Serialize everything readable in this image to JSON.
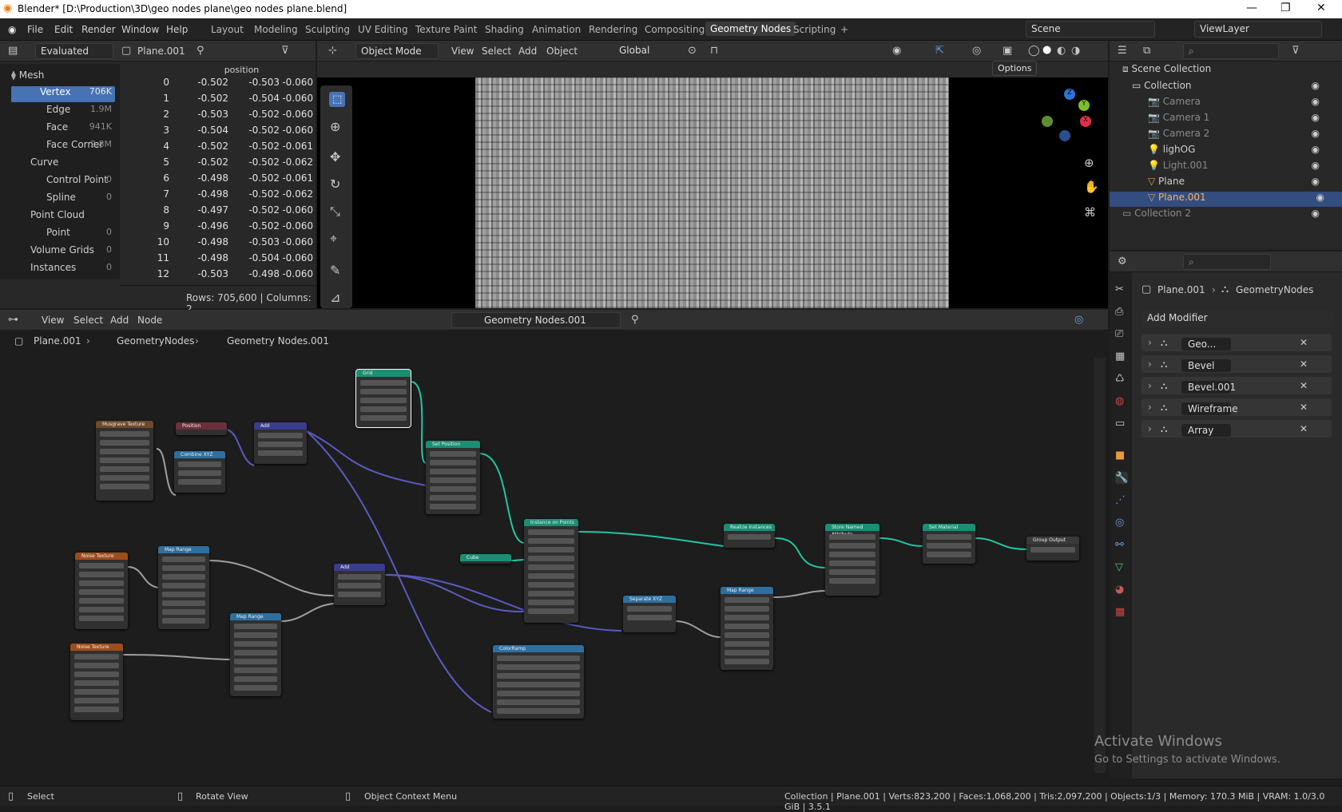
{
  "title": "Blender* [D:\\Production\\3D\\geo nodes plane\\geo nodes plane.blend]",
  "menu": [
    "File",
    "Edit",
    "Render",
    "Window",
    "Help"
  ],
  "workspaces": [
    "Layout",
    "Modeling",
    "Sculpting",
    "UV Editing",
    "Texture Paint",
    "Shading",
    "Animation",
    "Rendering",
    "Compositing",
    "Geometry Nodes",
    "Scripting"
  ],
  "scene": "Scene",
  "view_layer": "ViewLayer",
  "spreadsheet": {
    "mode": "Evaluated",
    "object": "Plane.001",
    "column": "position",
    "sidebar": [
      {
        "label": "Mesh",
        "count": ""
      },
      {
        "label": "Vertex",
        "count": "706K"
      },
      {
        "label": "Edge",
        "count": "1.9M"
      },
      {
        "label": "Face",
        "count": "941K"
      },
      {
        "label": "Face Corner",
        "count": "2.8M"
      },
      {
        "label": "Curve",
        "count": ""
      },
      {
        "label": "Control Point",
        "count": "0"
      },
      {
        "label": "Spline",
        "count": "0"
      },
      {
        "label": "Point Cloud",
        "count": ""
      },
      {
        "label": "Point",
        "count": "0"
      },
      {
        "label": "Volume Grids",
        "count": "0"
      },
      {
        "label": "Instances",
        "count": "0"
      }
    ],
    "rows": [
      [
        "0",
        "-0.502",
        "-0.503",
        "-0.060"
      ],
      [
        "1",
        "-0.502",
        "-0.504",
        "-0.060"
      ],
      [
        "2",
        "-0.503",
        "-0.502",
        "-0.060"
      ],
      [
        "3",
        "-0.504",
        "-0.502",
        "-0.060"
      ],
      [
        "4",
        "-0.502",
        "-0.502",
        "-0.061"
      ],
      [
        "5",
        "-0.502",
        "-0.502",
        "-0.062"
      ],
      [
        "6",
        "-0.498",
        "-0.502",
        "-0.061"
      ],
      [
        "7",
        "-0.498",
        "-0.502",
        "-0.062"
      ],
      [
        "8",
        "-0.497",
        "-0.502",
        "-0.060"
      ],
      [
        "9",
        "-0.496",
        "-0.502",
        "-0.060"
      ],
      [
        "10",
        "-0.498",
        "-0.503",
        "-0.060"
      ],
      [
        "11",
        "-0.498",
        "-0.504",
        "-0.060"
      ],
      [
        "12",
        "-0.503",
        "-0.498",
        "-0.060"
      ]
    ],
    "footer": "Rows: 705,600   |   Columns: 2"
  },
  "viewport": {
    "mode": "Object Mode",
    "menu": [
      "View",
      "Select",
      "Add",
      "Object"
    ],
    "orient": "Global",
    "options": "Options"
  },
  "outliner": {
    "root": "Scene Collection",
    "items": [
      {
        "label": "Collection"
      },
      {
        "label": "Camera"
      },
      {
        "label": "Camera 1"
      },
      {
        "label": "Camera 2"
      },
      {
        "label": "lighOG"
      },
      {
        "label": "Light.001"
      },
      {
        "label": "Plane"
      },
      {
        "label": "Plane.001"
      },
      {
        "label": "Collection 2"
      }
    ]
  },
  "properties": {
    "object": "Plane.001",
    "modifier": "GeometryNodes",
    "add_modifier": "Add Modifier",
    "modifiers": [
      "Geo...",
      "Bevel",
      "Bevel.001",
      "Wireframe",
      "Array"
    ]
  },
  "node_editor": {
    "menu": [
      "View",
      "Select",
      "Add",
      "Node"
    ],
    "tree": "Geometry Nodes.001",
    "breadcrumb": [
      "Plane.001",
      "GeometryNodes",
      "Geometry Nodes.001"
    ],
    "nodes": {
      "grid": "Grid",
      "musgrave": "Musgrave Texture",
      "position": "Position",
      "combine": "Combine XYZ",
      "add1": "Add",
      "set_position": "Set Position",
      "instance": "Instance on Points",
      "realize": "Realize Instances",
      "store": "Store Named Attribute",
      "set_material": "Set Material",
      "output": "Group Output",
      "noise1": "Noise Texture",
      "noise2": "Noise Texture",
      "maprange1": "Map Range",
      "maprange2": "Map Range",
      "maprange3": "Map Range",
      "add2": "Add",
      "cube": "Cube",
      "separate": "Separate XYZ",
      "colorramp": "ColorRamp"
    }
  },
  "watermark": {
    "line1": "Activate Windows",
    "line2": "Go to Settings to activate Windows."
  },
  "status": {
    "left": [
      "Select",
      "Rotate View",
      "Object Context Menu"
    ],
    "right": "Collection | Plane.001 | Verts:823,200 | Faces:1,068,200 | Tris:2,097,200 | Objects:1/3 | Memory: 170.3 MiB | VRAM: 1.0/3.0 GiB | 3.5.1"
  }
}
